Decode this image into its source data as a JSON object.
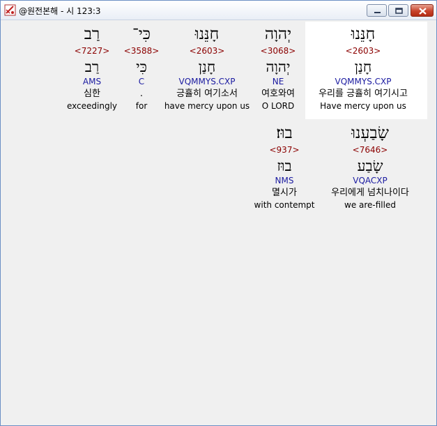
{
  "window": {
    "title": "@원전본해 - 시 123:3"
  },
  "colors": {
    "strong": "#8b0000",
    "morph": "#1a1aa0",
    "highlight_bg": "#ffffff"
  },
  "rows": [
    {
      "words": [
        {
          "hebrew": "חָנֵּנוּ",
          "strong": "<2603>",
          "lemma": "חָנַן",
          "morph": "VQMMYS.CXP",
          "korean": "우리를 긍휼히 여기시고",
          "english": "Have mercy upon us",
          "highlighted": true
        },
        {
          "hebrew": "יְהוָה",
          "strong": "<3068>",
          "lemma": "יְהוָה",
          "morph": "NE",
          "korean": "여호와여",
          "english": "O LORD"
        },
        {
          "hebrew": "חָנֵּנוּ",
          "strong": "<2603>",
          "lemma": "חָנַן",
          "morph": "VQMMYS.CXP",
          "korean": "긍휼히 여기소서",
          "english": "have mercy upon us"
        },
        {
          "hebrew": "כִּי־",
          "strong": "<3588>",
          "lemma": "כִּי",
          "morph": "C",
          "korean": ".",
          "english": "for"
        },
        {
          "hebrew": "רַב",
          "strong": "<7227>",
          "lemma": "רַב",
          "morph": "AMS",
          "korean": "심한",
          "english": "exceedingly"
        }
      ]
    },
    {
      "words": [
        {
          "hebrew": "שָׂבַעְנוּ",
          "strong": "<7646>",
          "lemma": "שָׂבַע",
          "morph": "VQACXP",
          "korean": "우리에게 넘치나이다",
          "english": "we are-filled"
        },
        {
          "hebrew": "בוּז׃",
          "strong": "<937>",
          "lemma": "בוּז",
          "morph": "NMS",
          "korean": "멸시가",
          "english": "with contempt"
        }
      ]
    }
  ]
}
